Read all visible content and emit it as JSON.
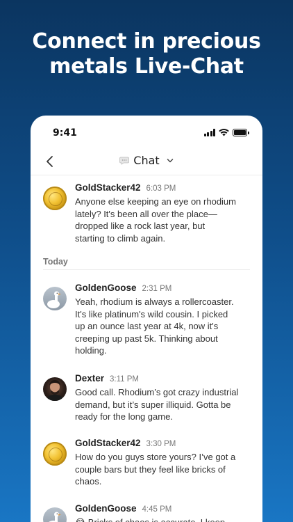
{
  "headline": {
    "line1": "Connect in precious",
    "line2": "metals Live-Chat"
  },
  "status_bar": {
    "time": "9:41"
  },
  "nav": {
    "back_icon": "chevron-left-icon",
    "title": "Chat",
    "dropdown_icon": "chevron-down-icon"
  },
  "day_divider": "Today",
  "messages": [
    {
      "author": "GoldStacker42",
      "time": "6:03 PM",
      "avatar": "gold-coin",
      "lines": [
        "Anyone else keeping an eye on rhodium",
        "lately? It's been all over the place—",
        "dropped like a rock last year, but",
        "starting to climb again."
      ]
    },
    {
      "author": "GoldenGoose",
      "time": "2:31 PM",
      "avatar": "goose",
      "lines": [
        "Yeah, rhodium is always a rollercoaster.",
        "It's like platinum's wild cousin. I picked",
        "up an ounce last year at 4k, now it's",
        "creeping up past 5k. Thinking about",
        "holding."
      ]
    },
    {
      "author": "Dexter",
      "time": "3:11 PM",
      "avatar": "dexter-photo",
      "lines": [
        "Good call. Rhodium’s got crazy industrial",
        "demand, but it’s super illiquid. Gotta be",
        "ready for the long game."
      ]
    },
    {
      "author": "GoldStacker42",
      "time": "3:30 PM",
      "avatar": "gold-coin",
      "lines": [
        "How do you guys store yours? I’ve got a",
        "couple bars but they feel like bricks of",
        "chaos."
      ]
    },
    {
      "author": "GoldenGoose",
      "time": "4:45 PM",
      "avatar": "goose",
      "lines": [
        "😂 Bricks of chaos is accurate. I keep"
      ]
    }
  ]
}
